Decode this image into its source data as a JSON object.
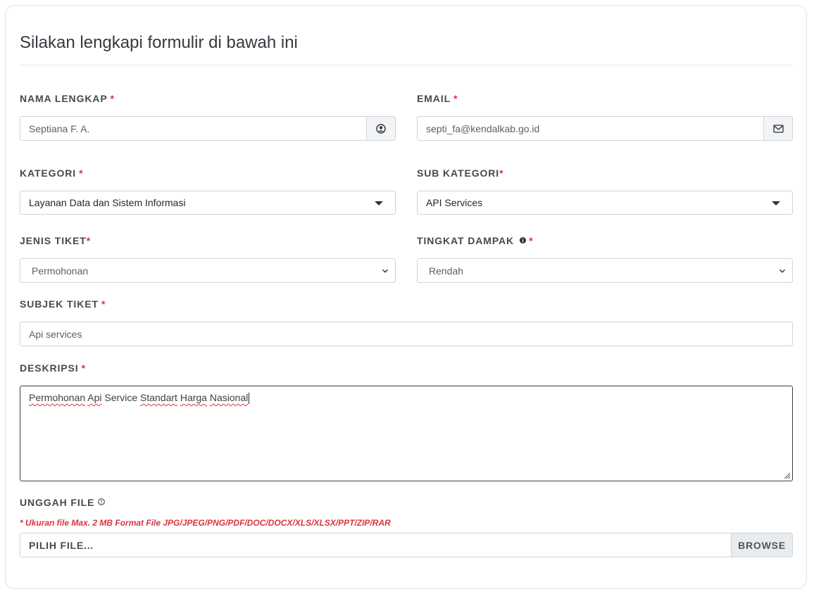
{
  "form": {
    "title": "Silakan lengkapi formulir di bawah ini",
    "required_mark": "*",
    "nama": {
      "label": "NAMA LENGKAP",
      "value": "Septiana F. A.",
      "icon": "user-circle-icon"
    },
    "email": {
      "label": "EMAIL",
      "value": "septi_fa@kendalkab.go.id",
      "icon": "envelope-icon"
    },
    "kategori": {
      "label": "KATEGORI",
      "value": "Layanan Data dan Sistem Informasi"
    },
    "sub_kategori": {
      "label": "SUB KATEGORI",
      "value": "API Services"
    },
    "jenis_tiket": {
      "label": "JENIS TIKET",
      "value": "Permohonan"
    },
    "tingkat_dampak": {
      "label": "TINGKAT DAMPAK",
      "value": "Rendah",
      "icon": "info-icon"
    },
    "subjek": {
      "label": "SUBJEK TIKET",
      "value": "Api services"
    },
    "deskripsi": {
      "label": "DESKRIPSI",
      "words": [
        "Permohonan",
        "Api",
        "Service",
        "Standart",
        "Harga",
        "Nasional"
      ]
    },
    "unggah": {
      "label": "UNGGAH FILE",
      "note": "* Ukuran file Max. 2 MB Format File JPG/JPEG/PNG/PDF/DOC/DOCX/XLS/XLSX/PPT/ZIP/RAR",
      "placeholder": "PILIH FILE...",
      "browse_label": "BROWSE",
      "icon": "info-outline-icon"
    }
  },
  "colors": {
    "required": "#d9343f",
    "border": "#cfd4d9",
    "addon_bg": "#f3f4f6",
    "label": "#444a50"
  }
}
